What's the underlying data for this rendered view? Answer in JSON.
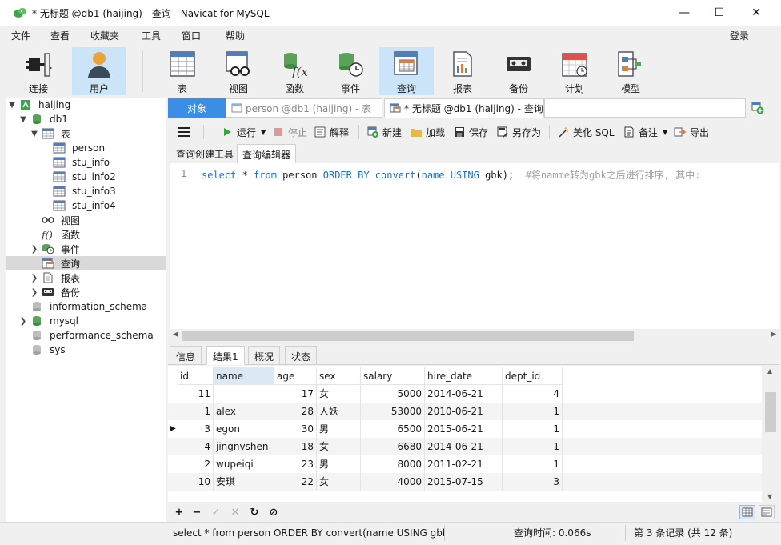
{
  "window": {
    "title": "* 无标题 @db1 (haijing) - 查询 - Navicat for MySQL",
    "minimize": "—",
    "maximize": "☐",
    "close": "✕"
  },
  "menu": {
    "items": [
      "文件",
      "查看",
      "收藏夹",
      "工具",
      "窗口",
      "帮助"
    ],
    "login": "登录"
  },
  "toolbar": {
    "buttons": [
      {
        "label": "连接",
        "icon": "plug-icon"
      },
      {
        "label": "用户",
        "icon": "user-icon"
      },
      {
        "label": "表",
        "icon": "table-icon"
      },
      {
        "label": "视图",
        "icon": "view-icon"
      },
      {
        "label": "函数",
        "icon": "function-icon"
      },
      {
        "label": "事件",
        "icon": "event-icon"
      },
      {
        "label": "查询",
        "icon": "query-icon"
      },
      {
        "label": "报表",
        "icon": "report-icon"
      },
      {
        "label": "备份",
        "icon": "backup-icon"
      },
      {
        "label": "计划",
        "icon": "calendar-icon"
      },
      {
        "label": "模型",
        "icon": "model-icon"
      }
    ]
  },
  "tree": {
    "connection": "haijing",
    "db": "db1",
    "tables_label": "表",
    "tables": [
      "person",
      "stu_info",
      "stu_info2",
      "stu_info3",
      "stu_info4"
    ],
    "view_label": "视图",
    "function_label": "函数",
    "event_label": "事件",
    "query_label": "查询",
    "report_label": "报表",
    "backup_label": "备份",
    "other_dbs": [
      "information_schema",
      "mysql",
      "performance_schema",
      "sys"
    ]
  },
  "tabs": {
    "objects": "对象",
    "table_tab": "person @db1 (haijing) - 表",
    "query_tab": "* 无标题 @db1 (haijing) - 查询"
  },
  "query_toolbar": {
    "run": "运行",
    "stop": "停止",
    "explain": "解释",
    "new": "新建",
    "load": "加载",
    "save": "保存",
    "save_as": "另存为",
    "beautify": "美化 SQL",
    "comment": "备注",
    "export": "导出"
  },
  "subtabs": {
    "builder": "查询创建工具",
    "editor": "查询编辑器"
  },
  "editor": {
    "line_number": "1",
    "code": {
      "t1": "select",
      "t2": " * ",
      "t3": "from",
      "t4": " person ",
      "t5": "ORDER BY",
      "t6": " ",
      "t7": "convert",
      "t8": "(",
      "t9": "name",
      "t10": " ",
      "t11": "USING",
      "t12": " gbk);  ",
      "t13": "#将namme转为gbk之后进行排序, 其中:"
    }
  },
  "result_tabs": [
    "信息",
    "结果1",
    "概况",
    "状态"
  ],
  "grid": {
    "columns": [
      "id",
      "name",
      "age",
      "sex",
      "salary",
      "hire_date",
      "dept_id"
    ],
    "rows": [
      [
        "11",
        "",
        "17",
        "女",
        "5000",
        "2014-06-21",
        "4"
      ],
      [
        "1",
        "alex",
        "28",
        "人妖",
        "53000",
        "2010-06-21",
        "1"
      ],
      [
        "3",
        "egon",
        "30",
        "男",
        "6500",
        "2015-06-21",
        "1"
      ],
      [
        "4",
        "jingnvshen",
        "18",
        "女",
        "6680",
        "2014-06-21",
        "1"
      ],
      [
        "2",
        "wupeiqi",
        "23",
        "男",
        "8000",
        "2011-02-21",
        "1"
      ],
      [
        "10",
        "安琪",
        "22",
        "女",
        "4000",
        "2015-07-15",
        "3"
      ]
    ],
    "current_row_marker": "▶"
  },
  "grid_bar": {
    "add": "+",
    "delete": "−",
    "apply": "✓",
    "discard": "✕",
    "refresh": "↻",
    "stop": "⊘"
  },
  "status": {
    "sql": "select * from person ORDER BY convert(name USING gbk",
    "query_time": "查询时间: 0.066s",
    "record": "第 3 条记录 (共 12 条)"
  },
  "colors": {
    "accent": "#3a8ee6",
    "selected_toolbar": "#cce4f7",
    "keyword": "#1e6ec8",
    "comment": "#a0a0a0"
  }
}
